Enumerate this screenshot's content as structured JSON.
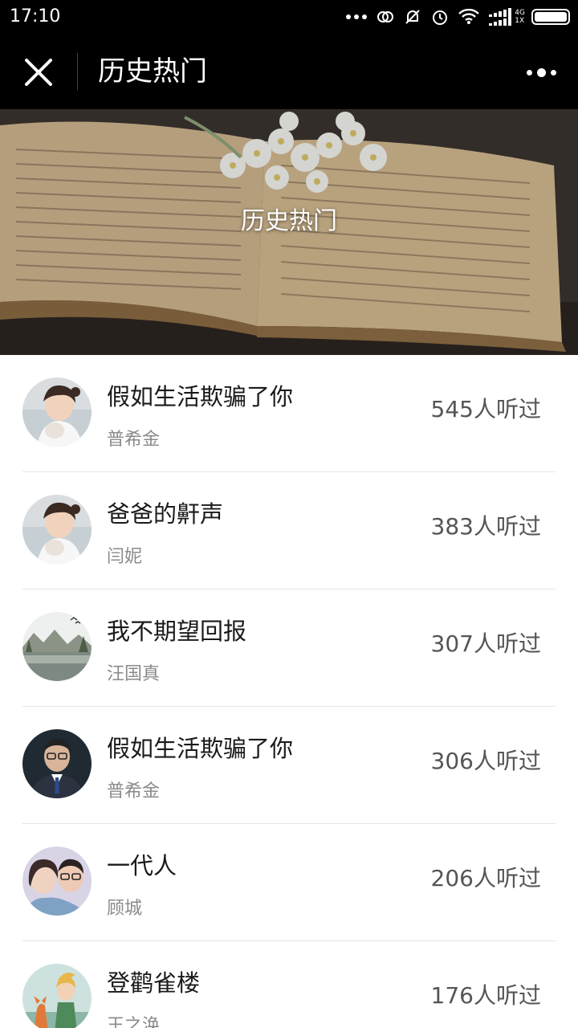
{
  "status_bar": {
    "time": "17:10",
    "network_top": "4G",
    "network_bottom": "1X",
    "icons": [
      "more-dots-icon",
      "sync-icon",
      "mute-bell-icon",
      "alarm-icon",
      "wifi-icon",
      "signal-icon",
      "battery-icon"
    ]
  },
  "nav": {
    "title": "历史热门",
    "close_icon": "close-icon",
    "more_icon": "more-icon"
  },
  "banner": {
    "title": "历史热门"
  },
  "items": [
    {
      "title": "假如生活欺骗了你",
      "author": "普希金",
      "count": "545人听过",
      "avatar": "girl-photo"
    },
    {
      "title": "爸爸的鼾声",
      "author": "闫妮",
      "count": "383人听过",
      "avatar": "girl-photo"
    },
    {
      "title": "我不期望回报",
      "author": "汪国真",
      "count": "307人听过",
      "avatar": "landscape-photo"
    },
    {
      "title": "假如生活欺骗了你",
      "author": "普希金",
      "count": "306人听过",
      "avatar": "man-photo"
    },
    {
      "title": "一代人",
      "author": "顾城",
      "count": "206人听过",
      "avatar": "couple-photo"
    },
    {
      "title": "登鹳雀楼",
      "author": "王之涣",
      "count": "176人听过",
      "avatar": "little-prince-photo"
    }
  ]
}
